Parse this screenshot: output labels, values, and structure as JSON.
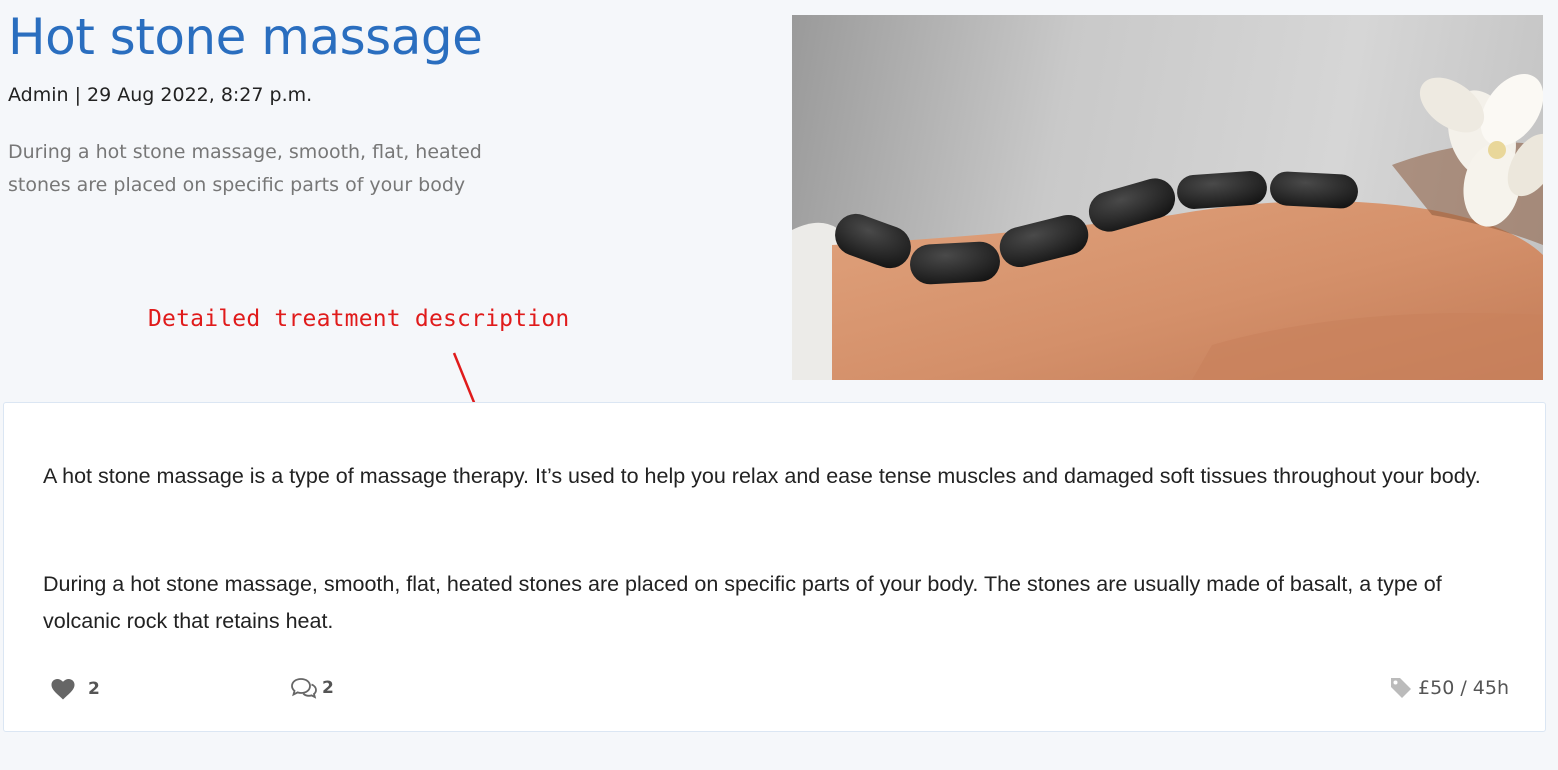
{
  "post": {
    "title": "Hot stone massage",
    "meta": "Admin | 29 Aug 2022, 8:27 p.m.",
    "excerpt": "During a hot stone massage, smooth, flat, heated stones are placed on specific parts of your body",
    "body": [
      "A hot stone massage is a type of massage therapy. It’s used to help you relax and ease tense muscles and damaged soft tissues throughout your body.",
      "During a hot stone massage, smooth, flat, heated stones are placed on specific parts of your body. The stones are usually made of basalt, a type of volcanic rock that retains heat."
    ],
    "likes": "2",
    "comments": "2",
    "price": "£50 / 45h"
  },
  "annotation": {
    "text": "Detailed treatment description",
    "color": "#e01b1b"
  },
  "icons": {
    "like": "heart-icon",
    "comment": "comments-icon",
    "price": "tag-icon"
  },
  "colors": {
    "title": "#2a6ebf",
    "background": "#f5f7fa",
    "card_border": "#dbe6f3"
  }
}
